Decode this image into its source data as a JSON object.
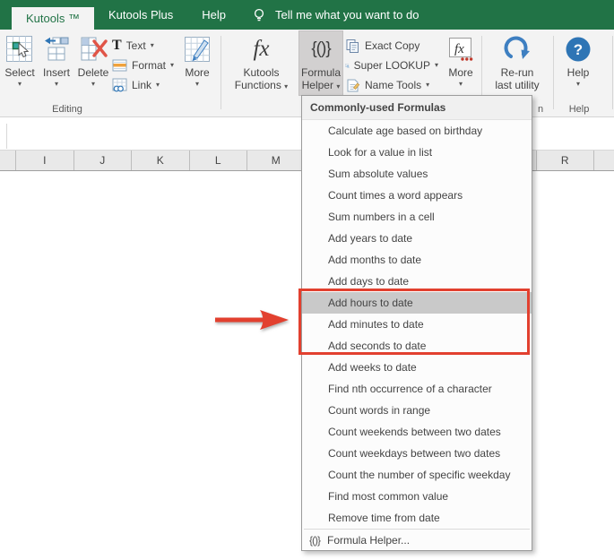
{
  "colors": {
    "brand_green": "#217346",
    "annotation_red": "#e2402f",
    "menu_highlight_gray": "#c9c9c9",
    "accent_blue": "#2e75b5"
  },
  "tabbar": {
    "active_tab": "Kutools ™",
    "tab_kutools_plus": "Kutools Plus",
    "tab_help": "Help",
    "tell_me": "Tell me what you want to do"
  },
  "ribbon": {
    "select": "Select",
    "insert": "Insert",
    "delete": "Delete",
    "text": "Text",
    "format": "Format",
    "link": "Link",
    "more_editing": "More",
    "kutools_functions_line1": "Kutools",
    "kutools_functions_line2": "Functions",
    "formula_helper_line1": "Formula",
    "formula_helper_line2": "Helper",
    "exact_copy": "Exact Copy",
    "super_lookup": "Super LOOKUP",
    "name_tools": "Name Tools",
    "more_formula": "More",
    "rerun_line1": "Re-run",
    "rerun_line2": "last utility",
    "help_button": "Help",
    "group_editing_label": "Editing",
    "group_partial_label": "n",
    "group_help_label": "Help"
  },
  "sheet": {
    "columns": [
      "",
      "I",
      "J",
      "K",
      "L",
      "M",
      "",
      "",
      "",
      "",
      "R",
      ""
    ]
  },
  "dropdown": {
    "header": "Commonly-used Formulas",
    "items": [
      "Calculate age based on birthday",
      "Look for a value in list",
      "Sum absolute values",
      "Count times a word appears",
      "Sum numbers in a cell",
      "Add years to date",
      "Add months to date",
      "Add days to date",
      "Add hours to date",
      "Add minutes to date",
      "Add seconds to date",
      "Add weeks to date",
      "Find nth occurrence of a character",
      "Count words in range",
      "Count weekends between two dates",
      "Count weekdays between two dates",
      "Count the number of specific weekday",
      "Find most common value",
      "Remove time from date"
    ],
    "highlighted_item": "Add hours to date",
    "footer": "Formula Helper..."
  },
  "icons": {
    "dropdown_caret": "▾",
    "fx": "fx",
    "curly_formula": "{()}",
    "text_t": "T",
    "question_mark": "?"
  }
}
